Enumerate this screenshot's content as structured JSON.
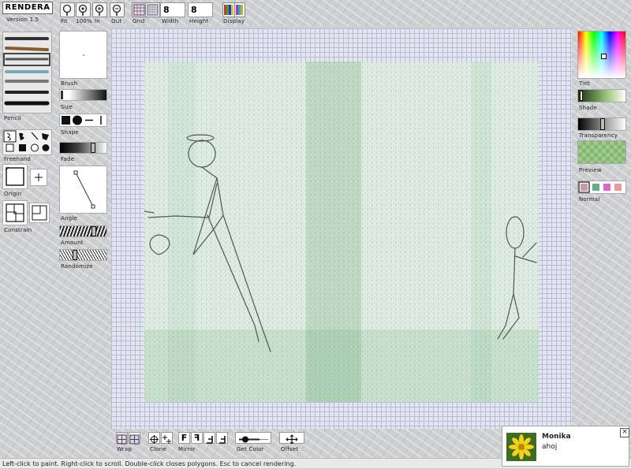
{
  "app": {
    "logo": "RENDERA",
    "version": "Version 1.5"
  },
  "toolbar": {
    "fit": "Fit",
    "zoom100": "100%",
    "zoom_in": "In",
    "zoom_out": "Out",
    "grid": "Grid",
    "width_label": "Width",
    "width_value": "8",
    "height_label": "Height",
    "height_value": "8",
    "display": "Display"
  },
  "left": {
    "pencil": "Pencil",
    "freehand": "Freehand",
    "origin": "Origin",
    "constrain": "Constrain"
  },
  "mid": {
    "brush": "Brush",
    "size": "Size",
    "shape": "Shape",
    "fade": "Fade",
    "angle": "Angle",
    "amount": "Amount",
    "randomize": "Randomize"
  },
  "right": {
    "tint": "Tint",
    "shade": "Shade",
    "transparency": "Transparency",
    "preview": "Preview",
    "normal": "Normal"
  },
  "bottom": {
    "wrap": "Wrap",
    "clone": "Clone",
    "mirror": "Mirror",
    "get_color": "Get Color",
    "offset": "Offset"
  },
  "status": "Left-click to paint. Right-click to scroll. Double-click closes polygons. Esc to cancel rendering.",
  "notification": {
    "name": "Monika",
    "message": "ahoj",
    "close": "×"
  },
  "colors": {
    "accent": "#2e8b3a",
    "grid": "#b7bdd0"
  }
}
